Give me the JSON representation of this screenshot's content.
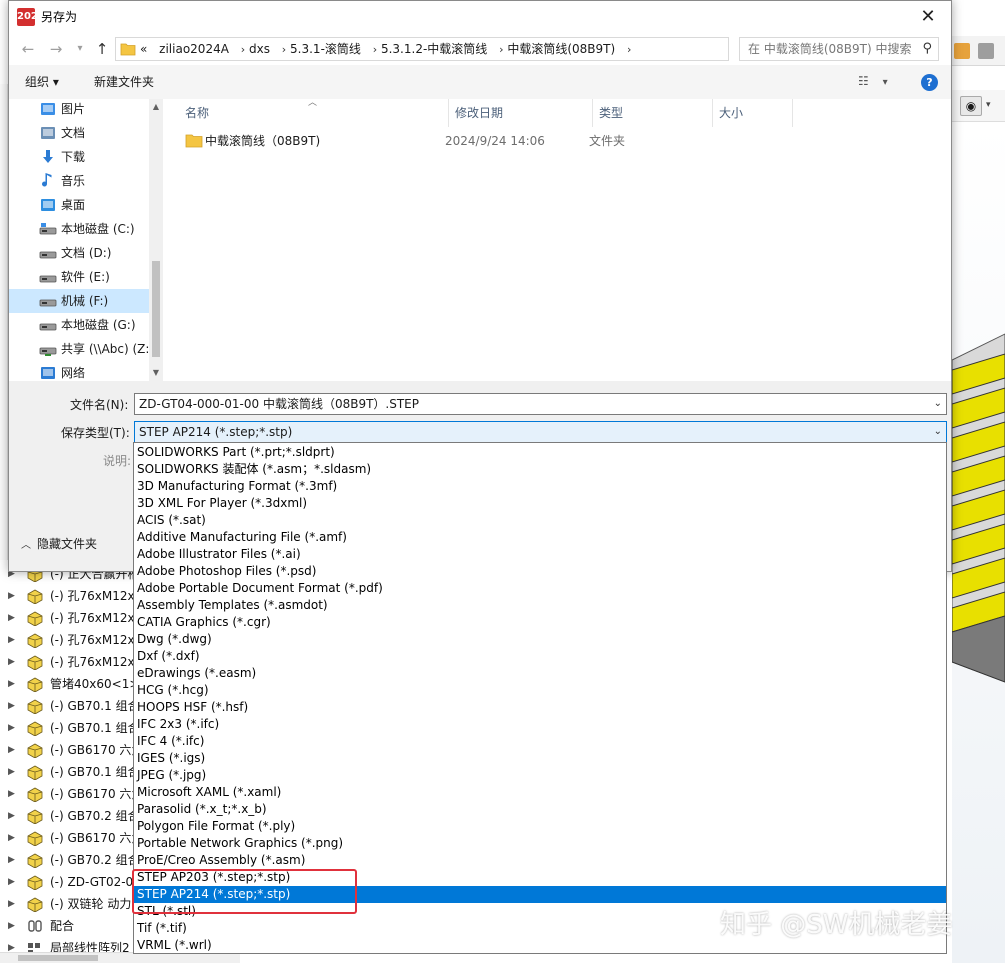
{
  "dialog": {
    "title": "另存为",
    "app_logo_text": "2024",
    "close_glyph": "✕"
  },
  "nav": {
    "breadcrumb_prefix": "«",
    "breadcrumbs": [
      "ziliao2024A",
      "dxs",
      "5.3.1-滚筒线",
      "5.3.1.2-中载滚筒线",
      "中载滚筒线(08B9T)"
    ],
    "search_placeholder": "在 中载滚筒线(08B9T) 中搜索"
  },
  "toolbar": {
    "organize_label": "组织 ▾",
    "new_folder_label": "新建文件夹",
    "help_label": "?"
  },
  "sidebar": {
    "items": [
      {
        "label": "图片",
        "icon": "pictures-icon"
      },
      {
        "label": "文档",
        "icon": "documents-icon"
      },
      {
        "label": "下载",
        "icon": "download-icon"
      },
      {
        "label": "音乐",
        "icon": "music-icon"
      },
      {
        "label": "桌面",
        "icon": "desktop-icon"
      },
      {
        "label": "本地磁盘 (C:)",
        "icon": "drive-c-icon"
      },
      {
        "label": "文档 (D:)",
        "icon": "drive-icon"
      },
      {
        "label": "软件 (E:)",
        "icon": "drive-icon"
      },
      {
        "label": "机械 (F:)",
        "icon": "drive-icon",
        "selected": true
      },
      {
        "label": "本地磁盘 (G:)",
        "icon": "drive-icon"
      },
      {
        "label": "共享 (\\\\Abc) (Z:",
        "icon": "network-drive-icon"
      },
      {
        "label": "网络",
        "icon": "network-icon"
      }
    ]
  },
  "file_list": {
    "columns": [
      "名称",
      "修改日期",
      "类型",
      "大小"
    ],
    "rows": [
      {
        "name": "中载滚筒线（08B9T)",
        "date": "2024/9/24 14:06",
        "type": "文件夹",
        "size": ""
      }
    ]
  },
  "form": {
    "filename_label": "文件名(N):",
    "filename_value": "ZD-GT04-000-01-00 中载滚筒线（08B9T）.STEP",
    "savetype_label": "保存类型(T):",
    "savetype_value": "STEP AP214 (*.step;*.stp)",
    "description_label": "说明:",
    "hide_folders_label": "隐藏文件夹"
  },
  "type_options": [
    "SOLIDWORKS Part (*.prt;*.sldprt)",
    "SOLIDWORKS 装配体 (*.asm；*.sldasm)",
    "3D Manufacturing Format (*.3mf)",
    "3D XML For Player (*.3dxml)",
    "ACIS (*.sat)",
    "Additive Manufacturing File (*.amf)",
    "Adobe Illustrator Files (*.ai)",
    "Adobe Photoshop Files  (*.psd)",
    "Adobe Portable Document Format (*.pdf)",
    "Assembly Templates (*.asmdot)",
    "CATIA Graphics (*.cgr)",
    "Dwg (*.dwg)",
    "Dxf (*.dxf)",
    "eDrawings (*.easm)",
    "HCG (*.hcg)",
    "HOOPS HSF (*.hsf)",
    "IFC 2x3 (*.ifc)",
    "IFC 4 (*.ifc)",
    "IGES (*.igs)",
    "JPEG (*.jpg)",
    "Microsoft XAML (*.xaml)",
    "Parasolid (*.x_t;*.x_b)",
    "Polygon File Format (*.ply)",
    "Portable Network Graphics (*.png)",
    "ProE/Creo Assembly (*.asm)",
    "STEP AP203 (*.step;*.stp)",
    "STEP AP214 (*.step;*.stp)",
    "STL (*.stl)",
    "Tif (*.tif)",
    "VRML (*.wrl)"
  ],
  "selected_type_index": 26,
  "feature_tree": {
    "items": [
      "(-) 正大合赢开槽",
      "(-) 孔76xM12x",
      "(-) 孔76xM12x",
      "(-) 孔76xM12x",
      "(-) 孔76xM12x",
      "管堵40x60<1>",
      "(-) GB70.1 组合",
      "(-) GB70.1 组合",
      "(-) GB6170 六角",
      "(-) GB70.1 组合",
      "(-) GB6170 六角",
      "(-) GB70.2 组合",
      "(-) GB6170 六角",
      "(-) GB70.2 组合",
      "(-) ZD-GT02-00",
      "(-) 双链轮 动力",
      "配合",
      "局部线性阵列2"
    ]
  },
  "watermark": "知乎 @SW机械老姜",
  "colors": {
    "selection_blue": "#0078d7",
    "nav_selected": "#cce8ff",
    "highlight_red": "#e0313c",
    "folder_yellow": "#f4c542",
    "roller_yellow": "#e8e000"
  }
}
